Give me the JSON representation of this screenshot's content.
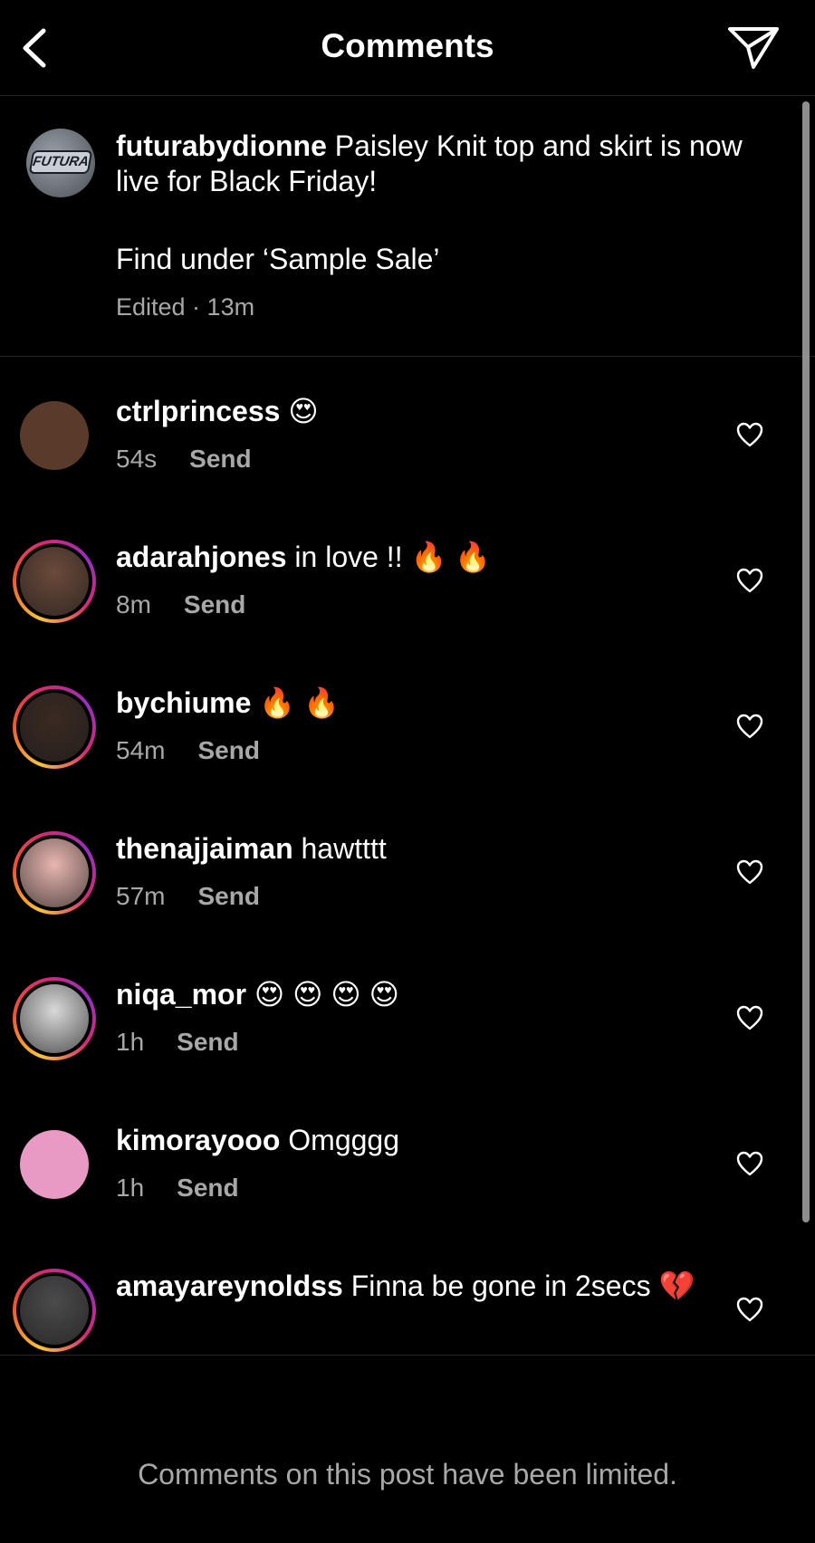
{
  "header": {
    "title": "Comments",
    "back_icon": "chevron-left-icon",
    "share_icon": "paper-plane-icon"
  },
  "caption": {
    "username": "futurabydionne",
    "text_line1": "Paisley Knit top and skirt is now live for Black Friday!",
    "text_line2": "Find under ‘Sample Sale’",
    "meta": "Edited · 13m",
    "avatar_label": "FUTURA"
  },
  "comments": [
    {
      "username": "ctrlprincess",
      "text": "😍",
      "time": "54s",
      "send": "Send",
      "story": false,
      "avatar_color": "#5a3a2a"
    },
    {
      "username": "adarahjones",
      "text": "in love !! 🔥 🔥",
      "time": "8m",
      "send": "Send",
      "story": true,
      "avatar_color": "#6b4a3a"
    },
    {
      "username": "bychiume",
      "text": "🔥 🔥",
      "time": "54m",
      "send": "Send",
      "story": true,
      "avatar_color": "#3a2a22"
    },
    {
      "username": "thenajjaiman",
      "text": "hawtttt",
      "time": "57m",
      "send": "Send",
      "story": true,
      "avatar_color": "#e8b6b0"
    },
    {
      "username": "niqa_mor",
      "text": "😍 😍 😍 😍",
      "time": "1h",
      "send": "Send",
      "story": true,
      "avatar_color": "#d9d9d9"
    },
    {
      "username": "kimorayooo",
      "text": "Omgggg",
      "time": "1h",
      "send": "Send",
      "story": false,
      "avatar_color": "#e89ac4"
    },
    {
      "username": "amayareynoldss",
      "text": "Finna be gone in 2secs 💔",
      "time": "",
      "send": "",
      "story": true,
      "avatar_color": "#4b4b4b"
    }
  ],
  "footer": {
    "limited_text": "Comments on this post have been limited."
  },
  "colors": {
    "background": "#000000",
    "text": "#ffffff",
    "secondary_text": "#a8a8a8",
    "divider": "#262626"
  }
}
